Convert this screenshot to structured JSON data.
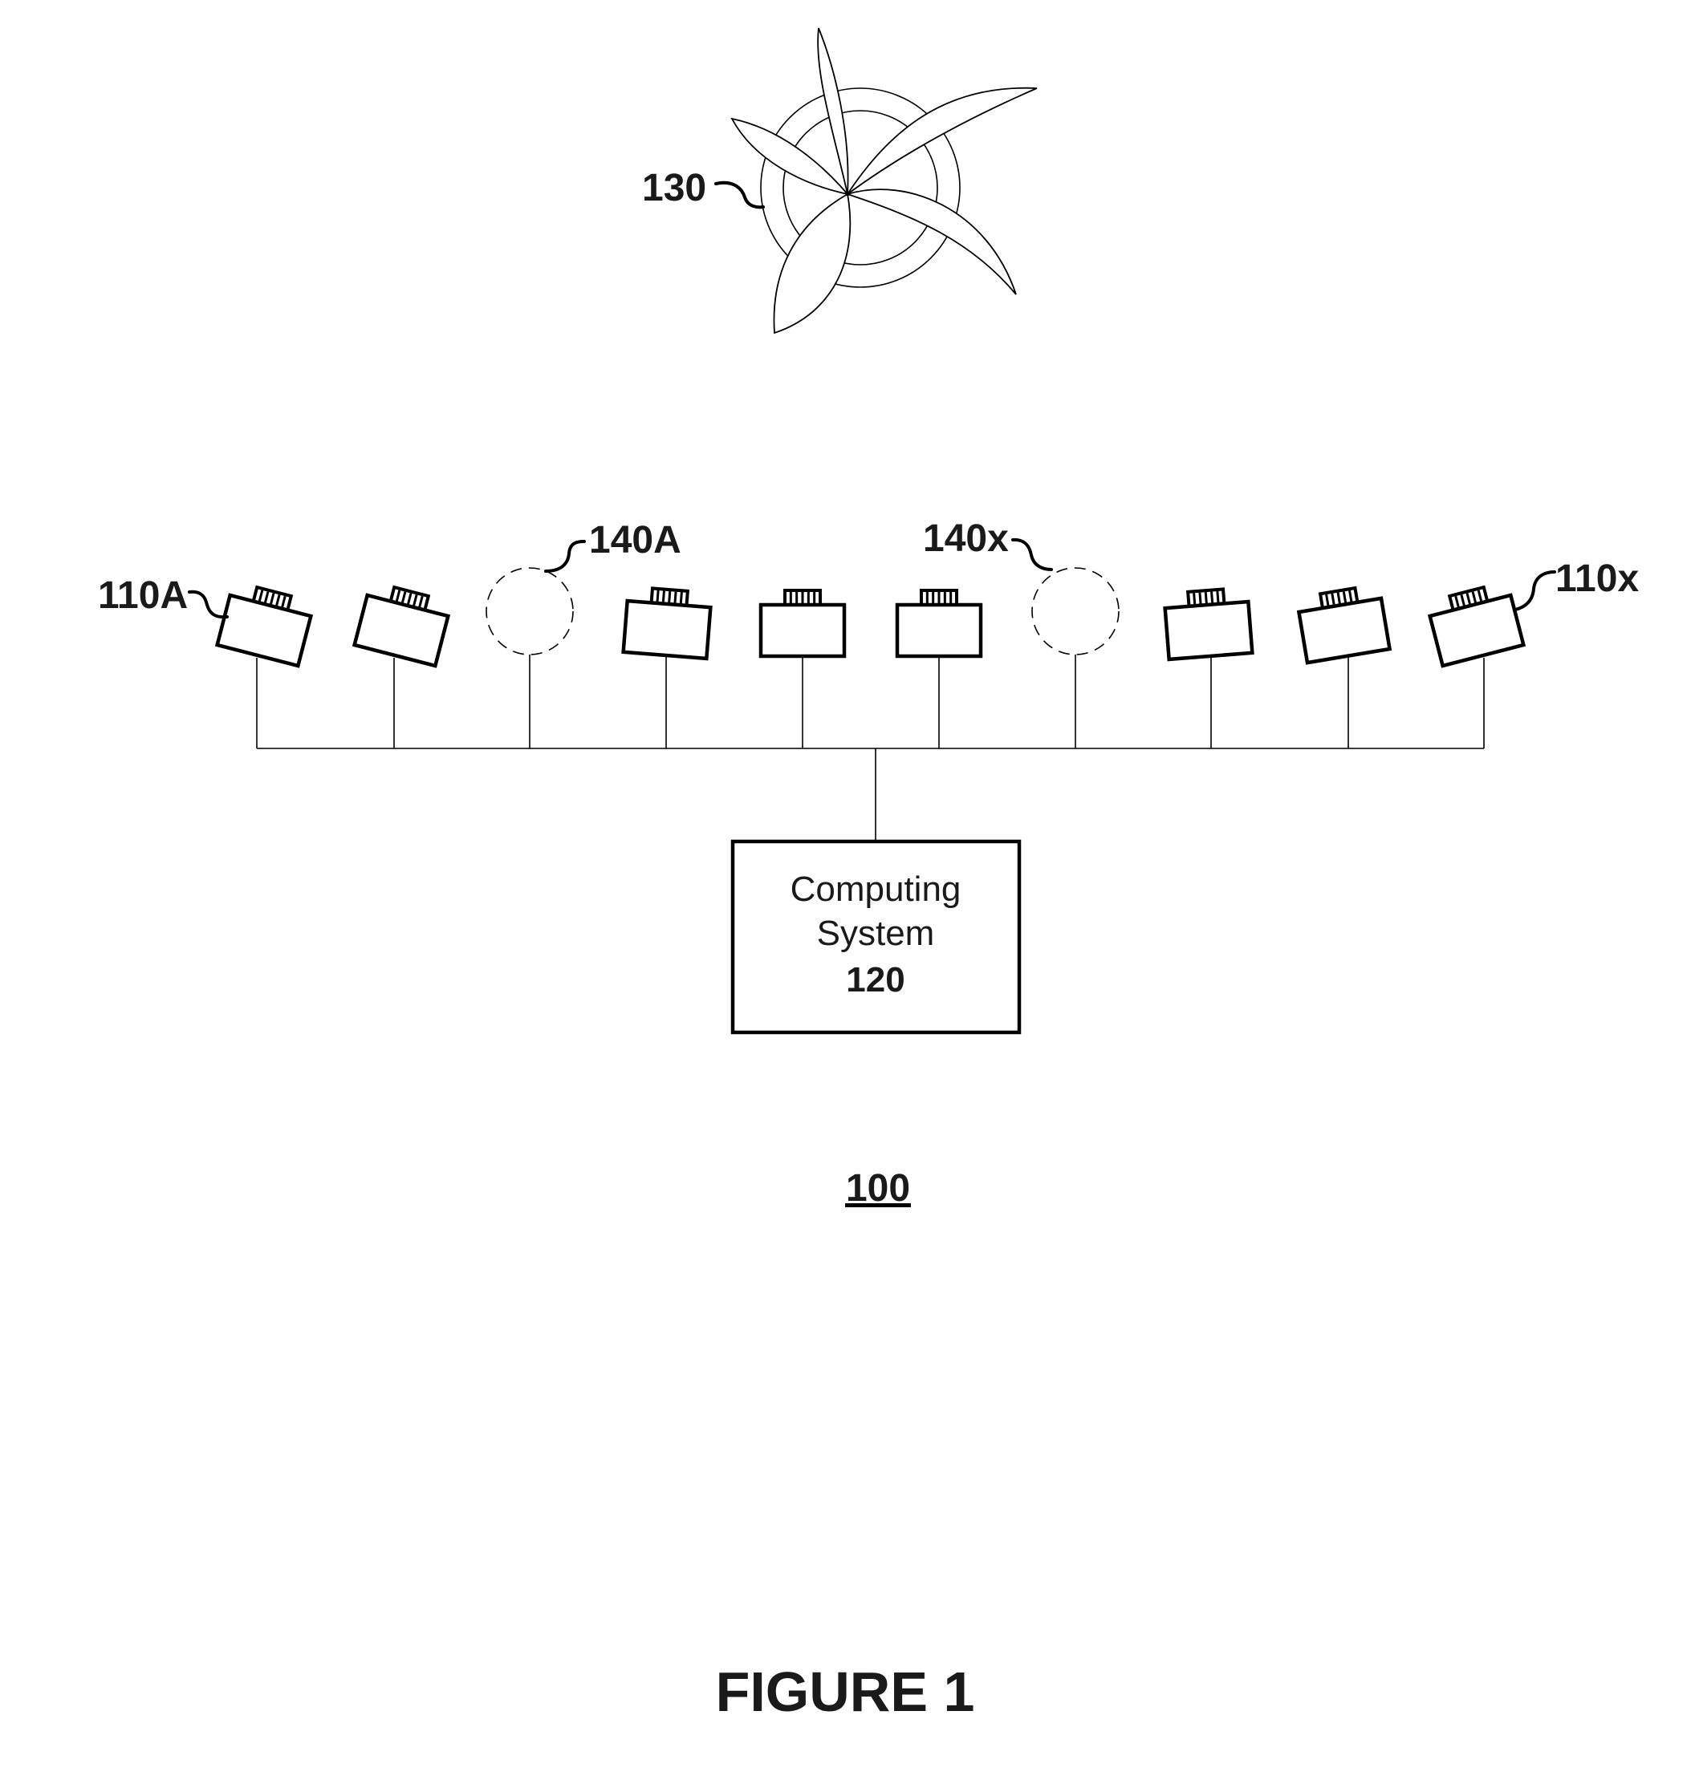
{
  "figure": {
    "title": "FIGURE 1",
    "system_ref": "100"
  },
  "target": {
    "ref": "130",
    "icon": "fan-icon"
  },
  "computing_system": {
    "line1": "Computing",
    "line2": "System",
    "ref": "120"
  },
  "devices": [
    {
      "type": "camera",
      "ref": "110A",
      "tilt_deg": 14.5
    },
    {
      "type": "camera",
      "ref": "",
      "tilt_deg": 14.5
    },
    {
      "type": "sensor",
      "ref": "140A",
      "tilt_deg": 0
    },
    {
      "type": "camera",
      "ref": "",
      "tilt_deg": 4.5
    },
    {
      "type": "camera",
      "ref": "",
      "tilt_deg": 0
    },
    {
      "type": "camera",
      "ref": "",
      "tilt_deg": 0
    },
    {
      "type": "sensor",
      "ref": "140x",
      "tilt_deg": 0
    },
    {
      "type": "camera",
      "ref": "",
      "tilt_deg": -4.5
    },
    {
      "type": "camera",
      "ref": "",
      "tilt_deg": -9.5
    },
    {
      "type": "camera",
      "ref": "110x",
      "tilt_deg": -14.5
    }
  ],
  "labels": {
    "camera_first": "110A",
    "camera_last": "110x",
    "sensor_first": "140A",
    "sensor_last": "140x"
  }
}
